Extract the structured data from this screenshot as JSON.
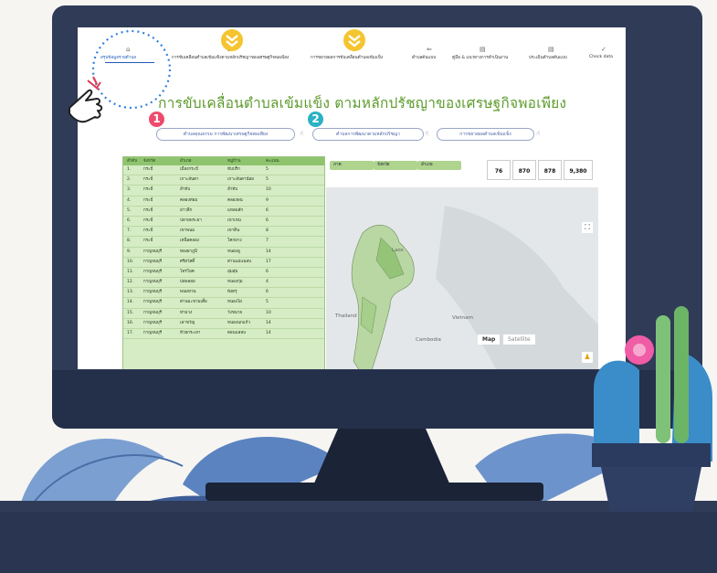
{
  "colors": {
    "monitor": "#2f3b57",
    "title_green": "#5d9b2c",
    "table_bg": "#d5ecc4",
    "badge_red": "#ee4a6b",
    "badge_teal": "#2ab1c5",
    "chevron_yellow": "#f5c531",
    "highlight_ring": "#2f7fe0"
  },
  "nav": {
    "items": [
      {
        "icon": "home-icon",
        "label": "สรุปข้อมูลรายตำบล"
      },
      {
        "icon": "globe-icon",
        "label": "การขับเคลื่อนตำบลเข้มแข็งตามหลักปรัชญาของเศรษฐกิจพอเพียง"
      },
      {
        "icon": "globe-icon",
        "label": "การขยายผลการขับเคลื่อนตำบลเข้มแข็ง"
      },
      {
        "icon": "double-arrow-icon",
        "label": "ตำบลต้นแบบ"
      },
      {
        "icon": "document-icon",
        "label": "คู่มือ & แนวทางการดำเนินงาน"
      },
      {
        "icon": "document-icon",
        "label": "ประเมินตำบลต้นแบบ"
      },
      {
        "icon": "check-icon",
        "label": "Check data"
      }
    ]
  },
  "main": {
    "title": "การขับเคลื่อนตำบลเข้มแข็ง ตามหลักปรัชญาของเศรษฐกิจพอเพียง",
    "filters": [
      "ตำบลคุณธรรม การพัฒนาเศรษฐกิจพอเพียง",
      "ตำบลการพัฒนาตามหลักปรัชญา",
      "การขยายผลตำบลเข้มแข็ง"
    ]
  },
  "table": {
    "headers": [
      "ลำดับ",
      "จังหวัด",
      "อำเภอ",
      "หมู่บ้าน",
      "คะแนน"
    ],
    "rows": [
      [
        "1.",
        "กระบี่",
        "เมืองกระบี่",
        "ทับปริก",
        "5"
      ],
      [
        "2.",
        "กระบี่",
        "เกาะลันตา",
        "เกาะลันตาน้อย",
        "5"
      ],
      [
        "3.",
        "กระบี่",
        "ลำทับ",
        "ลำทับ",
        "10"
      ],
      [
        "4.",
        "กระบี่",
        "คลองท่อม",
        "คลองพน",
        "9"
      ],
      [
        "5.",
        "กระบี่",
        "อ่าวลึก",
        "แหลมสัก",
        "6"
      ],
      [
        "6.",
        "กระบี่",
        "ปลายพระยา",
        "เขาเขน",
        "6"
      ],
      [
        "7.",
        "กระบี่",
        "เขาพนม",
        "เขาดิน",
        "8"
      ],
      [
        "8.",
        "กระบี่",
        "เหนือคลอง",
        "โคกยาง",
        "7"
      ],
      [
        "9.",
        "กาญจนบุรี",
        "ทองผาภูมิ",
        "หนองลู",
        "14"
      ],
      [
        "10.",
        "กาญจนบุรี",
        "ศรีสวัสดิ์",
        "ด่านแม่แฉลบ",
        "17"
      ],
      [
        "11.",
        "กาญจนบุรี",
        "ไทรโยค",
        "ลุ่มสุ่ม",
        "6"
      ],
      [
        "12.",
        "กาญจนบุรี",
        "บ่อพลอย",
        "หนองกุ่ม",
        "4"
      ],
      [
        "13.",
        "กาญจนบุรี",
        "พนมทวน",
        "พังตรุ",
        "6"
      ],
      [
        "14.",
        "กาญจนบุรี",
        "ด่านมะขามเตี้ย",
        "หนองไผ่",
        "5"
      ],
      [
        "15.",
        "กาญจนบุรี",
        "ท่าม่วง",
        "วังขนาย",
        "10"
      ],
      [
        "16.",
        "กาญจนบุรี",
        "เลาขวัญ",
        "หนองนกแก้ว",
        "14"
      ],
      [
        "17.",
        "กาญจนบุรี",
        "ห้วยกระเจา",
        "ดอนแสลบ",
        "14"
      ]
    ]
  },
  "dashboard": {
    "filters": [
      "ภาค",
      "จังหวัด",
      "อำเภอ"
    ],
    "stats": [
      "76",
      "870",
      "878",
      "9,380"
    ],
    "map_type_buttons": [
      "Map",
      "Satellite"
    ],
    "map_labels": [
      "Laos",
      "Vietnam",
      "Cambodia",
      "Thailand"
    ]
  },
  "badges": [
    "1",
    "2"
  ]
}
